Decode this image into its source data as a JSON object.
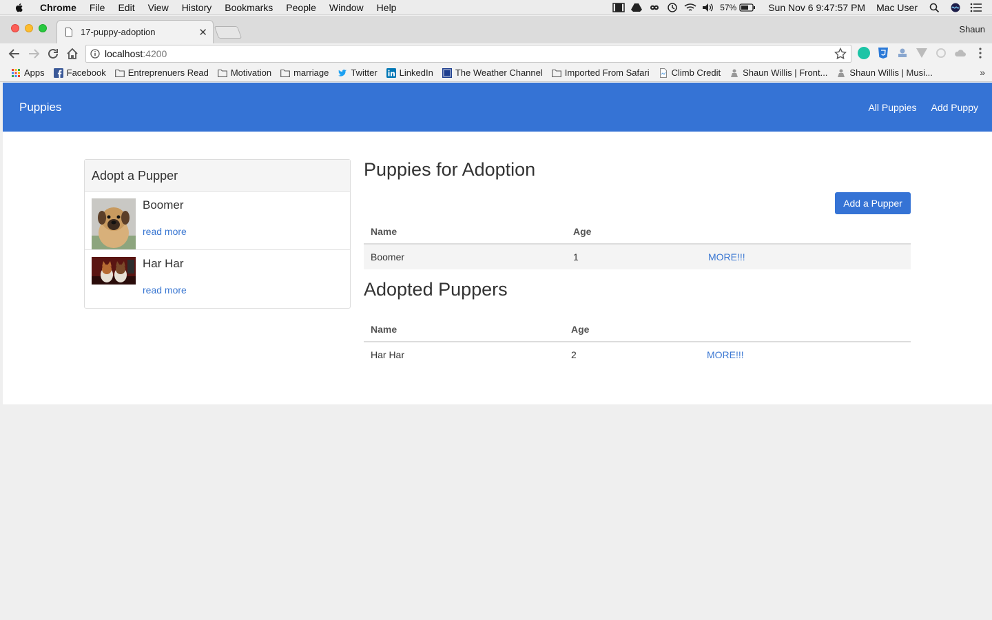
{
  "menubar": {
    "app": "Chrome",
    "items": [
      "File",
      "Edit",
      "View",
      "History",
      "Bookmarks",
      "People",
      "Window",
      "Help"
    ],
    "battery": "57%",
    "clock": "Sun Nov 6  9:47:57 PM",
    "user": "Mac User"
  },
  "browser": {
    "tab_title": "17-puppy-adoption",
    "profile": "Shaun",
    "url_host": "localhost",
    "url_port": ":4200",
    "bookmarks": [
      {
        "label": "Apps",
        "icon": "apps-grid-icon"
      },
      {
        "label": "Facebook",
        "icon": "facebook-icon"
      },
      {
        "label": "Entreprenuers Read",
        "icon": "folder-icon"
      },
      {
        "label": "Motivation",
        "icon": "folder-icon"
      },
      {
        "label": "marriage",
        "icon": "folder-icon"
      },
      {
        "label": "Twitter",
        "icon": "twitter-icon"
      },
      {
        "label": "LinkedIn",
        "icon": "linkedin-icon"
      },
      {
        "label": "The Weather Channel",
        "icon": "weather-icon"
      },
      {
        "label": "Imported From Safari",
        "icon": "folder-icon"
      },
      {
        "label": "Climb Credit",
        "icon": "page-icon"
      },
      {
        "label": "Shaun Willis | Front...",
        "icon": "site-icon"
      },
      {
        "label": "Shaun Willis | Musi...",
        "icon": "site-icon"
      }
    ],
    "bookmarks_overflow": "»"
  },
  "app": {
    "brand": "Puppies",
    "nav": {
      "all": "All Puppies",
      "add": "Add Puppy"
    },
    "panel": {
      "title": "Adopt a Pupper",
      "items": [
        {
          "name": "Boomer",
          "link": "read more"
        },
        {
          "name": "Har Har",
          "link": "read more"
        }
      ]
    },
    "adoption": {
      "heading": "Puppies for Adoption",
      "add_button": "Add a Pupper",
      "columns": [
        "Name",
        "Age"
      ],
      "rows": [
        {
          "name": "Boomer",
          "age": "1",
          "link": "MORE!!!"
        }
      ]
    },
    "adopted": {
      "heading": "Adopted Puppers",
      "columns": [
        "Name",
        "Age"
      ],
      "rows": [
        {
          "name": "Har Har",
          "age": "2",
          "link": "MORE!!!"
        }
      ]
    }
  },
  "colors": {
    "navbar": "#3573d5",
    "link": "#3a77d2"
  }
}
